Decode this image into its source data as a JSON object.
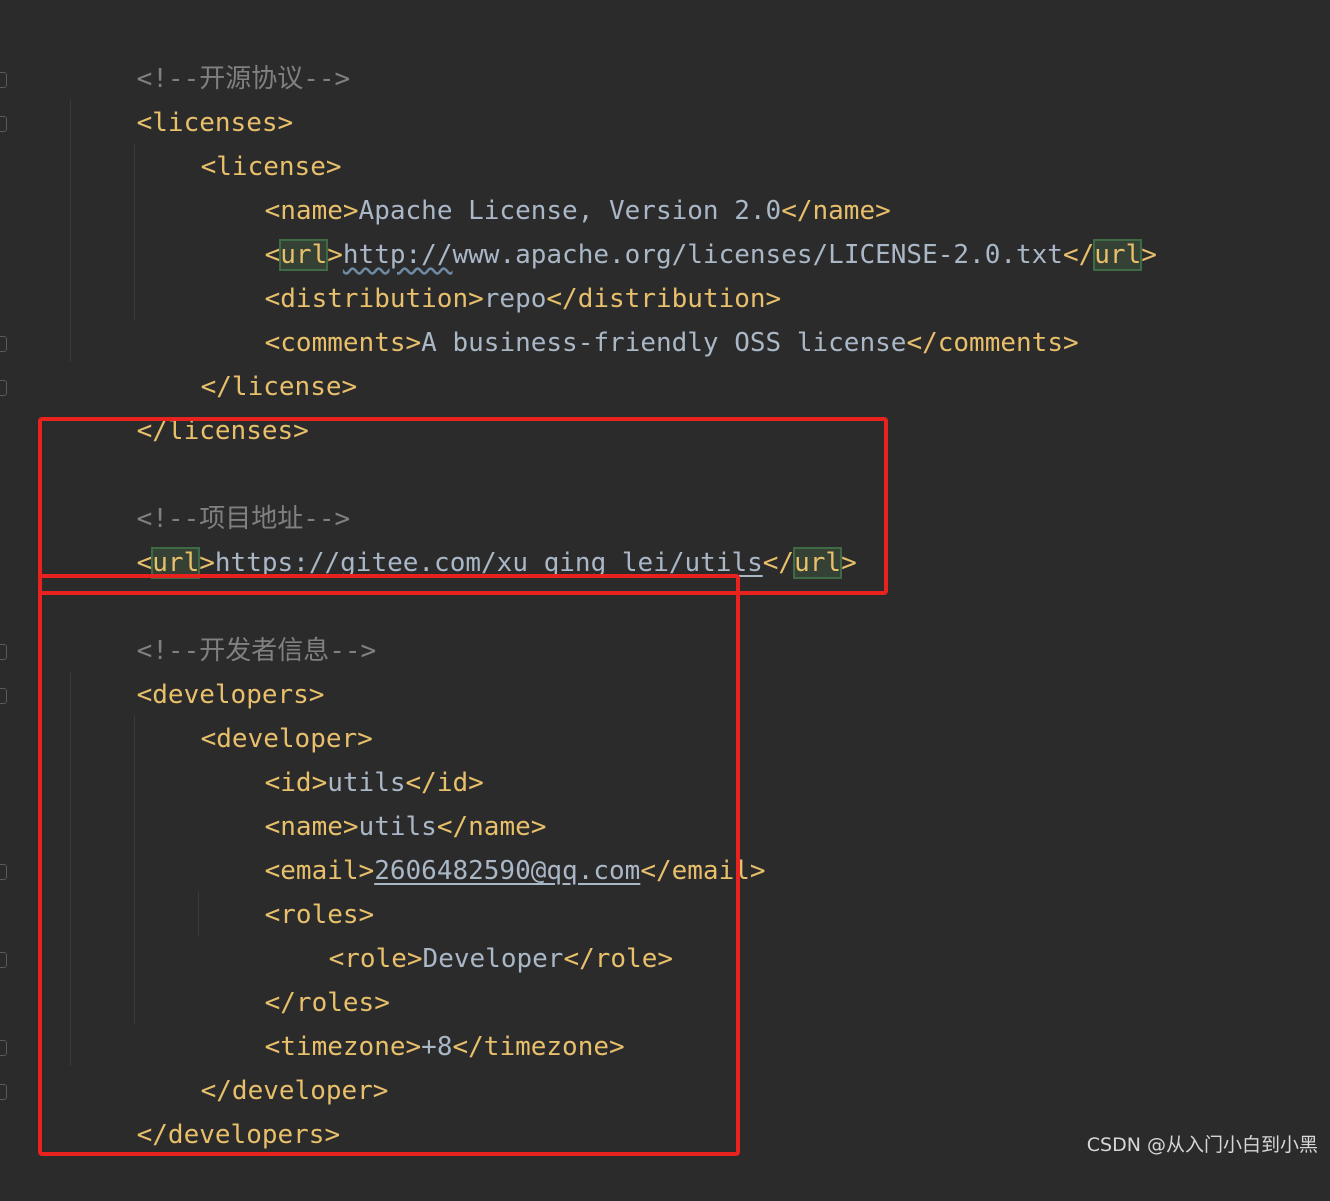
{
  "lines": {
    "c1": "<!--开源协议-->",
    "licenses_open": "<licenses>",
    "license_open": "<license>",
    "name_open": "<name>",
    "name_text": "Apache License, Version 2.0",
    "name_close": "</name>",
    "url_lt": "<",
    "url_name": "url",
    "url_gt": ">",
    "url_text_scheme": "http://",
    "url_text_rest": "www.apache.org/licenses/LICENSE-2.0.txt",
    "url_close_lt": "</",
    "dist_open": "<distribution>",
    "dist_text": "repo",
    "dist_close": "</distribution>",
    "comments_open": "<comments>",
    "comments_text": "A business-friendly OSS license",
    "comments_close": "</comments>",
    "license_close": "</license>",
    "licenses_close": "</licenses>",
    "c2": "<!--项目地址-->",
    "proj_url_text": "https://gitee.com/xu_qing_lei/utils",
    "c3": "<!--开发者信息-->",
    "developers_open": "<developers>",
    "developer_open": "<developer>",
    "id_open": "<id>",
    "id_text": "utils",
    "id_close": "</id>",
    "name2_text": "utils",
    "email_open": "<email>",
    "email_text": "2606482590@qq.com",
    "email_close": "</email>",
    "roles_open": "<roles>",
    "role_open": "<role>",
    "role_text": "Developer",
    "role_close": "</role>",
    "roles_close": "</roles>",
    "tz_open": "<timezone>",
    "tz_text": "+8",
    "tz_close": "</timezone>",
    "developer_close": "</developer>",
    "developers_close": "</developers>"
  },
  "watermark": "CSDN @从入门小白到小黑",
  "colors": {
    "background": "#2b2b2b",
    "tag": "#e8bf6a",
    "text": "#a9b7c6",
    "comment": "#808080",
    "highlight": "#344134",
    "annotation_box": "#e8221f"
  }
}
